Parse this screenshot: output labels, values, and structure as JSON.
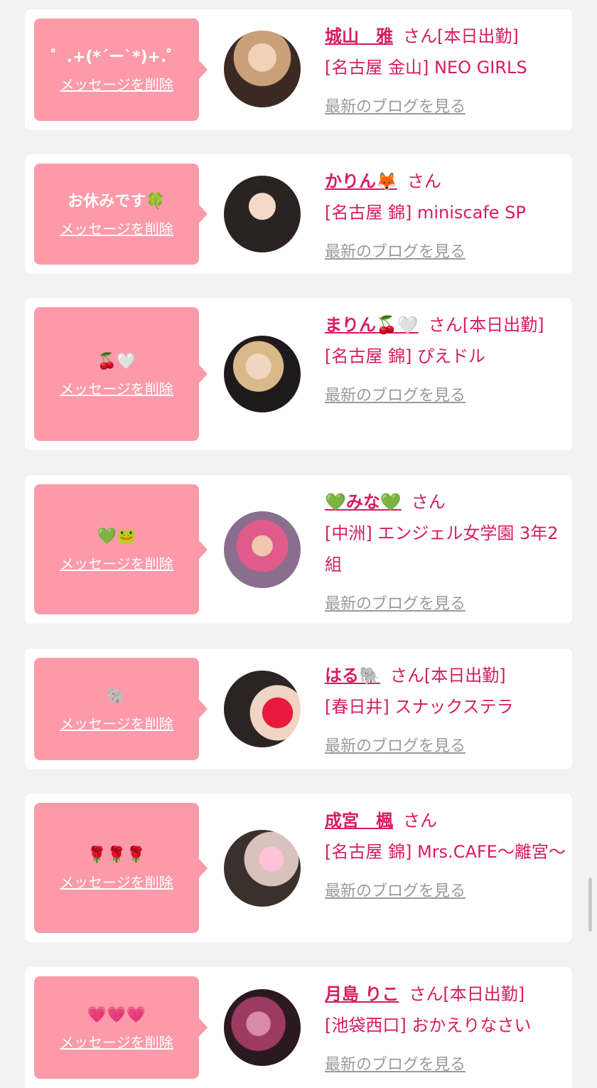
{
  "delete_label": "メッセージを削除",
  "blog_label": "最新のブログを見る",
  "honorific": "さん",
  "colors": {
    "accent": "#d81b60",
    "bubble": "#fc9aa9",
    "background": "#f2f2f2"
  },
  "cards": [
    {
      "message": "゜.+(*´ー`*)+.゜",
      "name": "城山　雅",
      "status": "[本日出勤]",
      "location": "[名古屋 金山] NEO GIRLS",
      "avatar": "photo"
    },
    {
      "message": "お休みです🍀",
      "name": "かりん🦊",
      "status": "",
      "location": "[名古屋 錦] miniscafe SP",
      "avatar": "photo"
    },
    {
      "message": "🍒🤍",
      "name": "まりん🍒🤍",
      "status": "[本日出勤]",
      "location": "[名古屋 錦] ぴえドル",
      "avatar": "photo"
    },
    {
      "message": "💚🐸",
      "name": "💚みな💚",
      "status": "",
      "location": "[中洲] エンジェル女学園 3年2組",
      "avatar": "photo"
    },
    {
      "message": "🐘",
      "name": "はる🐘",
      "status": "[本日出勤]",
      "location": "[春日井] スナックステラ",
      "avatar": "photo"
    },
    {
      "message": "🌹🌹🌹",
      "name": "成宮　楓",
      "status": "",
      "location": "[名古屋 錦] Mrs.CAFE〜離宮〜",
      "avatar": "photo"
    },
    {
      "message": "💗💗💗",
      "name": "月島 りこ",
      "status": "[本日出勤]",
      "location": "[池袋西口] おかえりなさい",
      "avatar": "photo"
    }
  ]
}
